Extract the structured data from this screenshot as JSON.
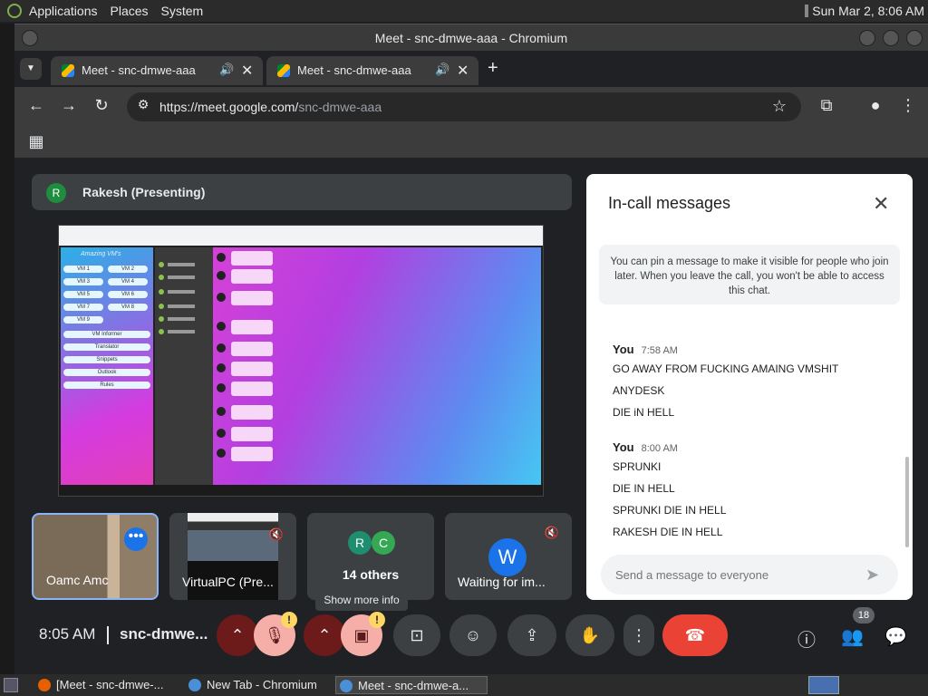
{
  "top_panel": {
    "menus": [
      "Applications",
      "Places",
      "System"
    ],
    "clock": "Sun Mar 2, 8:06 AM"
  },
  "window": {
    "title": "Meet - snc-dmwe-aaa - Chromium"
  },
  "tabs": [
    {
      "title": "Meet - snc-dmwe-aaa",
      "audio_icon": "🔊",
      "close": "✕"
    },
    {
      "title": "Meet - snc-dmwe-aaa",
      "audio_icon": "🔊",
      "close": "✕"
    }
  ],
  "toolbar": {
    "url_host": "https://meet.google.com/",
    "url_path": "snc-dmwe-aaa"
  },
  "meet": {
    "presenter_initial": "R",
    "presenter_label": "Rakesh (Presenting)",
    "shared_screen": {
      "brand": "Amazing VM's",
      "vm_buttons": [
        "VM 1",
        "VM 2",
        "VM 3",
        "VM 4",
        "VM 5",
        "VM 6",
        "VM 7",
        "VM 8",
        "VM 9"
      ],
      "menu_buttons": [
        "VM Informer",
        "Translator",
        "Snippets",
        "Outlook",
        "Rules"
      ]
    },
    "tiles": [
      {
        "label": "Oamc Amc",
        "more_icon": "•••"
      },
      {
        "label": "VirtualPC (Pre..."
      },
      {
        "label": "14 others",
        "avatars": [
          "R",
          "C"
        ]
      },
      {
        "label": "Waiting for im...",
        "avatar": "W"
      }
    ],
    "tooltip": "Show more info",
    "meeting_time": "8:05 AM",
    "meeting_code": "snc-dmwe...",
    "people_count": "18",
    "warning_mark": "!"
  },
  "chat": {
    "title": "In-call messages",
    "pin_note": "You can pin a message to make it visible for people who join later. When you leave the call, you won't be able to access this chat.",
    "groups": [
      {
        "sender": "You",
        "time": "7:58 AM",
        "messages": [
          "GO AWAY FROM FUCKING AMAING VMSHIT",
          "ANYDESK",
          "DIE iN HELL"
        ]
      },
      {
        "sender": "You",
        "time": "8:00 AM",
        "messages": [
          "SPRUNKI",
          "DIE IN HELL",
          "SPRUNKI DIE IN HELL",
          "RAKESH DIE IN HELL"
        ]
      }
    ],
    "input_placeholder": "Send a message to everyone"
  },
  "taskbar": {
    "items": [
      "[Meet - snc-dmwe-...",
      "New Tab - Chromium",
      "Meet - snc-dmwe-a..."
    ]
  }
}
